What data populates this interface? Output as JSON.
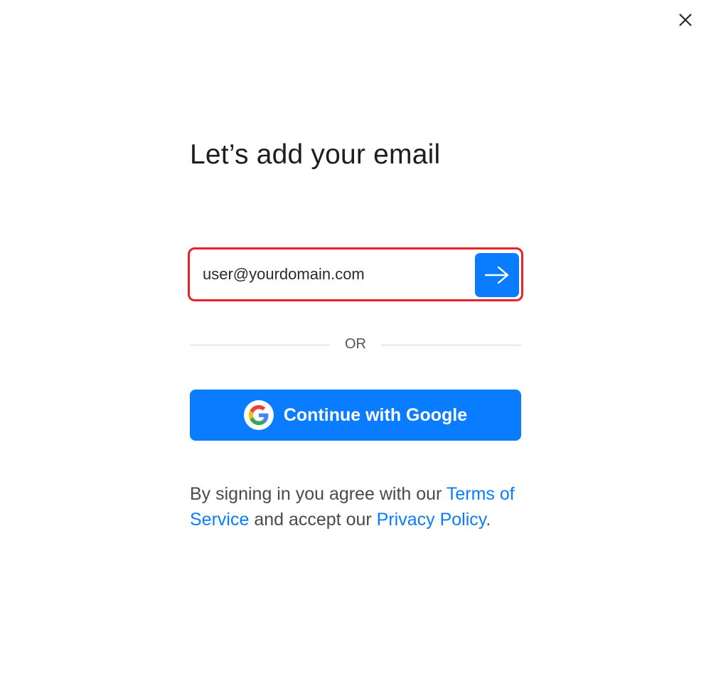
{
  "dialog": {
    "close_icon": "close-icon",
    "title": "Let’s add your email"
  },
  "email_form": {
    "input_value": "user@yourdomain.com",
    "submit_icon": "arrow-right-icon",
    "highlight_color": "#e8222a"
  },
  "divider": {
    "label": "OR"
  },
  "google_button": {
    "icon": "google-icon",
    "label": "Continue with Google"
  },
  "terms": {
    "text_1": "By signing in you agree with our ",
    "terms_link": "Terms of Service",
    "text_2": " and accept our ",
    "privacy_link": "Privacy Policy",
    "text_3": "."
  },
  "colors": {
    "accent": "#0a7cff",
    "text": "#1e1e1e",
    "muted_text": "#4a4a4a",
    "divider": "#d4d4d4"
  }
}
